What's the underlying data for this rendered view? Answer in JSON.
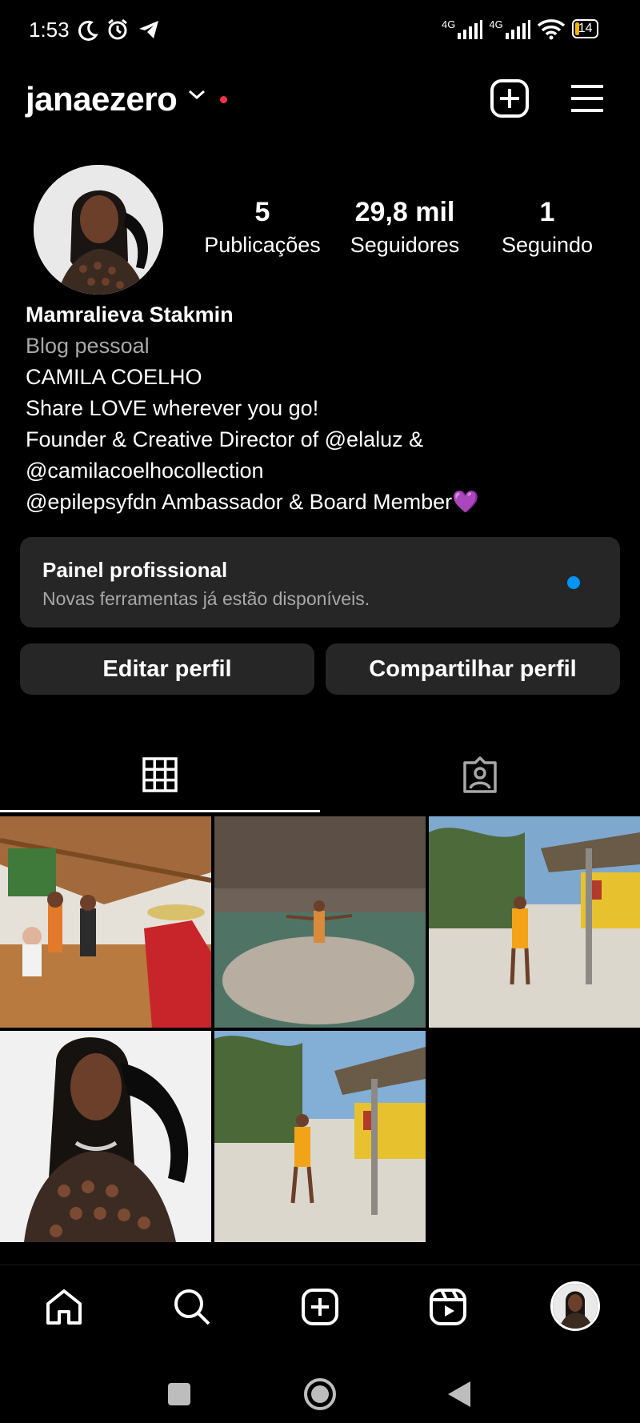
{
  "status_bar": {
    "time": "1:53",
    "network_1": "4G",
    "network_2": "4G",
    "battery": "14",
    "battery_level": 0.14,
    "icons": [
      "moon-icon",
      "alarm-icon",
      "telegram-icon",
      "signal-icon",
      "signal-icon",
      "wifi-icon",
      "battery-icon"
    ]
  },
  "header": {
    "username": "janaezero",
    "icons": [
      "chevron-down-icon",
      "notification-dot",
      "add-post-icon",
      "menu-icon"
    ]
  },
  "profile": {
    "stats": [
      {
        "value": "5",
        "label": "Publicações"
      },
      {
        "value": "29,8 mil",
        "label": "Seguidores"
      },
      {
        "value": "1",
        "label": "Seguindo"
      }
    ],
    "name": "Mamralieva Stakmin",
    "category": "Blog pessoal",
    "bio_lines": [
      "CAMILA COELHO",
      "Share LOVE wherever you go!",
      "Founder & Creative Director of @elaluz &",
      "@camilacoelhocollection",
      "@epilepsyfdn Ambassador & Board Member💜"
    ]
  },
  "dashboard": {
    "title": "Painel profissional",
    "subtitle": "Novas ferramentas já estão disponíveis."
  },
  "actions": {
    "edit_profile": "Editar perfil",
    "share_profile": "Compartilhar perfil"
  },
  "tabs": [
    {
      "icon": "grid-icon",
      "active": true
    },
    {
      "icon": "tagged-icon",
      "active": false
    }
  ],
  "posts": [
    {
      "description": "bar-group-photo"
    },
    {
      "description": "cenote-pool-photo"
    },
    {
      "description": "yellow-outfit-hammock-photo"
    },
    {
      "description": "portrait-black-outfit-photo"
    },
    {
      "description": "yellow-outfit-pose-photo"
    }
  ],
  "bottom_nav": [
    "home-icon",
    "search-icon",
    "create-icon",
    "reels-icon",
    "profile-avatar"
  ],
  "colors": {
    "background": "#000000",
    "card": "#262626",
    "muted_text": "#a8a8a8",
    "accent_blue": "#0095f6",
    "notification_red": "#ff3040"
  }
}
